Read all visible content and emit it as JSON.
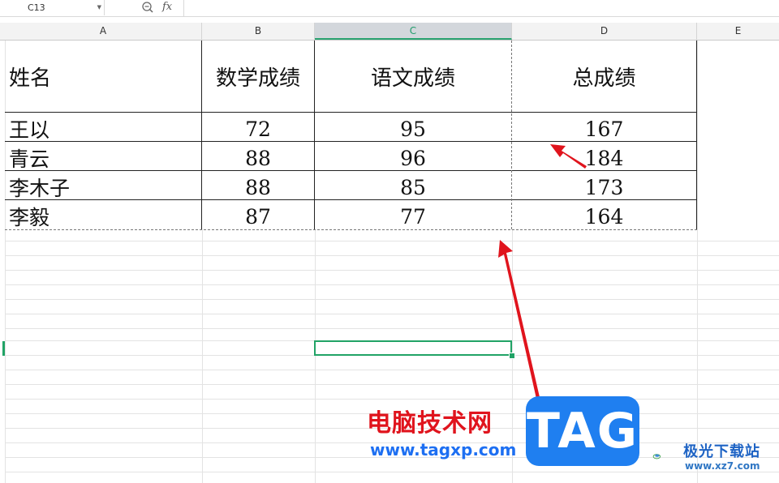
{
  "formula_bar": {
    "name_box": "C13",
    "fx_label": "fx",
    "formula": ""
  },
  "columns": [
    "A",
    "B",
    "C",
    "D",
    "E"
  ],
  "active_column": "C",
  "table": {
    "headers": [
      "姓名",
      "数学成绩",
      "语文成绩",
      "总成绩"
    ],
    "rows": [
      [
        "王以",
        "72",
        "95",
        "167"
      ],
      [
        "青云",
        "88",
        "96",
        "184"
      ],
      [
        "李木子",
        "88",
        "85",
        "173"
      ],
      [
        "李毅",
        "87",
        "77",
        "164"
      ]
    ]
  },
  "watermark": {
    "site_name": "电脑技术网",
    "site_url": "www.tagxp.com",
    "logo_text": "TAG",
    "partner_name": "极光下载站",
    "partner_url": "www.xz7.com"
  },
  "colors": {
    "selection": "#21a366",
    "annotation_arrow": "#e0141d",
    "logo_blue": "#1f7ff0"
  }
}
